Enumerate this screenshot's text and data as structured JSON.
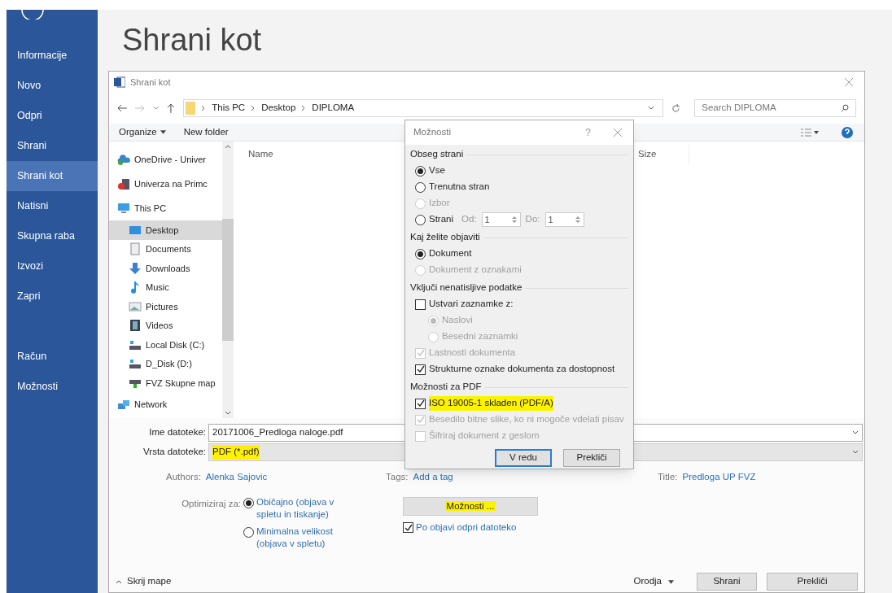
{
  "backstage": {
    "title": "Shrani kot",
    "items": [
      {
        "label": "Informacije",
        "selected": false
      },
      {
        "label": "Novo",
        "selected": false
      },
      {
        "label": "Odpri",
        "selected": false
      },
      {
        "label": "Shrani",
        "selected": false
      },
      {
        "label": "Shrani kot",
        "selected": true
      },
      {
        "label": "Natisni",
        "selected": false
      },
      {
        "label": "Skupna raba",
        "selected": false
      },
      {
        "label": "Izvozi",
        "selected": false
      },
      {
        "label": "Zapri",
        "selected": false
      }
    ],
    "bottom_items": [
      {
        "label": "Račun",
        "selected": false
      },
      {
        "label": "Možnosti",
        "selected": false
      }
    ]
  },
  "dialog": {
    "title": "Shrani kot",
    "path": [
      "This PC",
      "Desktop",
      "DIPLOMA"
    ],
    "search": {
      "placeholder": "Search DIPLOMA"
    },
    "toolbar": {
      "organize": "Organize",
      "new_folder": "New folder"
    },
    "nav": [
      {
        "label": "OneDrive - Univer",
        "kind": "cloud",
        "selected": false
      },
      {
        "label": "Univerza na Primc",
        "kind": "org",
        "selected": false
      },
      {
        "label": "This PC",
        "kind": "pc",
        "selected": false,
        "children": [
          {
            "label": "Desktop",
            "kind": "desktop",
            "selected": true
          },
          {
            "label": "Documents",
            "kind": "documents",
            "selected": false
          },
          {
            "label": "Downloads",
            "kind": "downloads",
            "selected": false
          },
          {
            "label": "Music",
            "kind": "music",
            "selected": false
          },
          {
            "label": "Pictures",
            "kind": "pictures",
            "selected": false
          },
          {
            "label": "Videos",
            "kind": "videos",
            "selected": false
          },
          {
            "label": "Local Disk (C:)",
            "kind": "disk",
            "selected": false
          },
          {
            "label": "D_Disk (D:)",
            "kind": "disk",
            "selected": false
          },
          {
            "label": "FVZ Skupne map",
            "kind": "netdrive",
            "selected": false
          }
        ]
      },
      {
        "label": "Network",
        "kind": "network",
        "selected": false
      }
    ],
    "columns": [
      "Name",
      "Size"
    ],
    "file_name": {
      "label": "Ime datoteke:",
      "value": "20171006_Predloga naloge.pdf"
    },
    "file_type": {
      "label": "Vrsta datoteke:",
      "value": "PDF (*.pdf)",
      "highlighted": true
    },
    "meta": [
      {
        "label": "Authors:",
        "value": "Alenka Sajovic"
      },
      {
        "label": "Tags:",
        "value": "Add a tag"
      },
      {
        "label": "Title:",
        "value": "Predloga UP FVZ"
      }
    ],
    "optimize": {
      "label": "Optimiziraj za:",
      "options": [
        {
          "label": "Običajno (objava v spletu in tiskanje)",
          "selected": true
        },
        {
          "label": "Minimalna velikost (objava v spletu)",
          "selected": false
        }
      ]
    },
    "options_button": {
      "label": "Možnosti ...",
      "highlighted": true
    },
    "open_after": {
      "label": "Po objavi odpri datoteko",
      "checked": true
    },
    "hide_folders": "Skrij mape",
    "tools": "Orodja",
    "buttons": [
      "Shrani",
      "Prekliči"
    ]
  },
  "options_dialog": {
    "title": "Možnosti",
    "help": "?",
    "groups": [
      {
        "title": "Obseg strani",
        "items": [
          {
            "kind": "radio",
            "label": "Vse",
            "selected": true,
            "disabled": false
          },
          {
            "kind": "radio",
            "label": "Trenutna stran",
            "selected": false,
            "disabled": false
          },
          {
            "kind": "radio",
            "label": "Izbor",
            "selected": false,
            "disabled": true
          },
          {
            "kind": "radio",
            "label": "Strani",
            "selected": false,
            "disabled": false,
            "from": {
              "label": "Od:",
              "value": "1"
            },
            "to": {
              "label": "Do:",
              "value": "1"
            }
          }
        ]
      },
      {
        "title": "Kaj želite objaviti",
        "items": [
          {
            "kind": "radio",
            "label": "Dokument",
            "selected": true,
            "disabled": false
          },
          {
            "kind": "radio",
            "label": "Dokument z oznakami",
            "selected": false,
            "disabled": true
          }
        ]
      },
      {
        "title": "Vključi nenatisljive podatke",
        "items": [
          {
            "kind": "checkbox",
            "label": "Ustvari zaznamke z:",
            "checked": false,
            "disabled": false,
            "children": [
              {
                "kind": "radio",
                "label": "Naslovi",
                "selected": true,
                "disabled": true
              },
              {
                "kind": "radio",
                "label": "Besedni zaznamki",
                "selected": false,
                "disabled": true
              }
            ]
          },
          {
            "kind": "checkbox",
            "label": "Lastnosti dokumenta",
            "checked": true,
            "disabled": true
          },
          {
            "kind": "checkbox",
            "label": "Strukturne oznake dokumenta za dostopnost",
            "checked": true,
            "disabled": false
          }
        ]
      },
      {
        "title": "Možnosti za PDF",
        "items": [
          {
            "kind": "checkbox",
            "label": "ISO 19005-1 skladen (PDF/A)",
            "checked": true,
            "disabled": false,
            "highlighted": true
          },
          {
            "kind": "checkbox",
            "label": "Besedilo bitne slike, ko ni mogoče vdelati pisav",
            "checked": true,
            "disabled": true
          },
          {
            "kind": "checkbox",
            "label": "Šifriraj dokument z geslom",
            "checked": false,
            "disabled": true
          }
        ]
      }
    ],
    "buttons": [
      {
        "label": "V redu",
        "default": true
      },
      {
        "label": "Prekliči",
        "default": false
      }
    ]
  }
}
